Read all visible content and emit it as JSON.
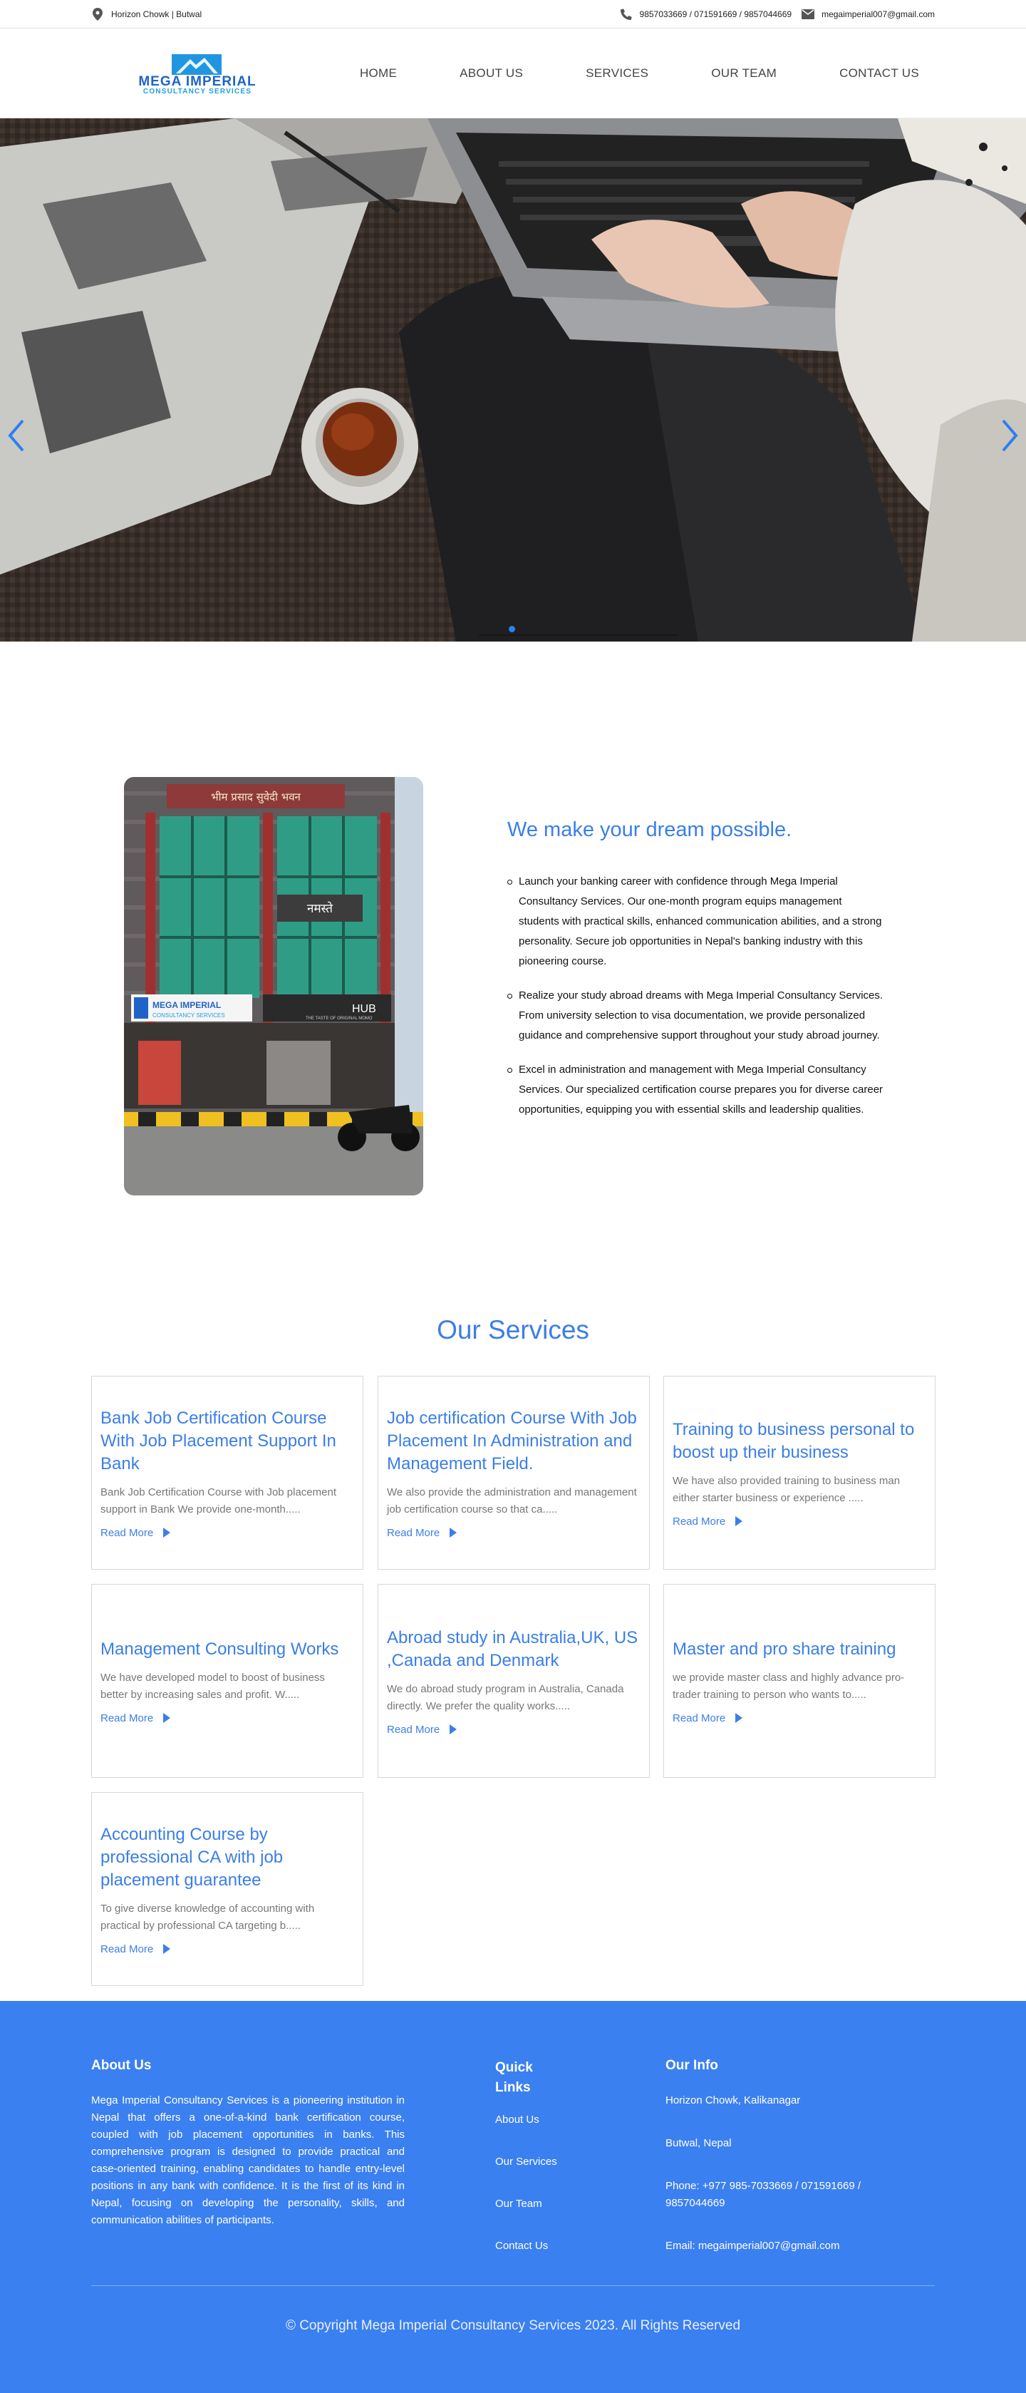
{
  "topbar": {
    "location": "Horizon Chowk | Butwal",
    "phones": "9857033669 / 071591669 / 9857044669",
    "email": "megaimperial007@gmail.com"
  },
  "logo": {
    "line1": "MEGA IMPERIAL",
    "line2": "CONSULTANCY SERVICES"
  },
  "nav": [
    "HOME",
    "ABOUT US",
    "SERVICES",
    "OUR TEAM",
    "CONTACT US"
  ],
  "photo_signs": {
    "top": "भीम प्रसाद सुवेदी भवन",
    "namaste": "नमस्ते",
    "left_line1": "MEGA IMPERIAL",
    "left_line2": "CONSULTANCY SERVICES",
    "right": "HUB",
    "right_sub": "THE TASTE OF ORIGINAL MOMO"
  },
  "about": {
    "heading": "We make your dream possible.",
    "points": [
      "Launch your banking career with confidence through Mega Imperial Consultancy Services. Our one-month program equips management students with practical skills, enhanced communication abilities, and a strong personality. Secure job opportunities in Nepal's banking industry with this pioneering course.",
      "Realize your study abroad dreams with Mega Imperial Consultancy Services. From university selection to visa documentation, we provide personalized guidance and comprehensive support throughout your study abroad journey.",
      "Excel in administration and management with Mega Imperial Consultancy Services. Our specialized certification course prepares you for diverse career opportunities, equipping you with essential skills and leadership qualities."
    ]
  },
  "services": {
    "title": "Our Services",
    "read_more": "Read More",
    "cards": [
      {
        "title": "Bank Job Certification Course With Job Placement Support In Bank",
        "desc": "Bank Job Certification Course with Job placement support in Bank We provide one-month....."
      },
      {
        "title": "Job certification Course With Job Placement In Administration and Management Field.",
        "desc": "We also provide the administration and management job certification course so that ca....."
      },
      {
        "title": "Training to business personal to boost up their business",
        "desc": "We have also provided training to business man either starter business or experience ....."
      },
      {
        "title": "Management Consulting Works",
        "desc": "We have developed model to boost of business better by increasing sales and profit. W....."
      },
      {
        "title": "Abroad study in Australia,UK, US ,Canada and Denmark",
        "desc": "We do abroad study program in Australia, Canada directly. We prefer the quality works....."
      },
      {
        "title": "Master and pro share training",
        "desc": "we provide master class and highly advance pro-trader training to person who wants to....."
      },
      {
        "title": "Accounting Course by professional CA with job placement guarantee",
        "desc": "To give diverse knowledge of accounting with practical by professional CA targeting b....."
      }
    ]
  },
  "footer": {
    "about_title": "About Us",
    "about_text": "Mega Imperial Consultancy Services is a pioneering institution in Nepal that offers a one-of-a-kind bank certification course, coupled with job placement opportunities in banks. This comprehensive program is designed to provide practical and case-oriented training, enabling candidates to handle entry-level positions in any bank with confidence. It is the first of its kind in Nepal, focusing on developing the personality, skills, and communication abilities of participants.",
    "links_title": "Quick Links",
    "links": [
      "About Us",
      "Our Services",
      "Our Team",
      "Contact Us"
    ],
    "info_title": "Our Info",
    "info": [
      "Horizon Chowk, Kalikanagar",
      "Butwal, Nepal",
      "Phone: +977 985-7033669 / 071591669 / 9857044669",
      "Email: megaimperial007@gmail.com"
    ],
    "copyright": "© Copyright Mega Imperial Consultancy Services 2023. All Rights Reserved"
  },
  "colors": {
    "accent": "#3b7ee8",
    "footer_bg": "#3b80f0"
  }
}
